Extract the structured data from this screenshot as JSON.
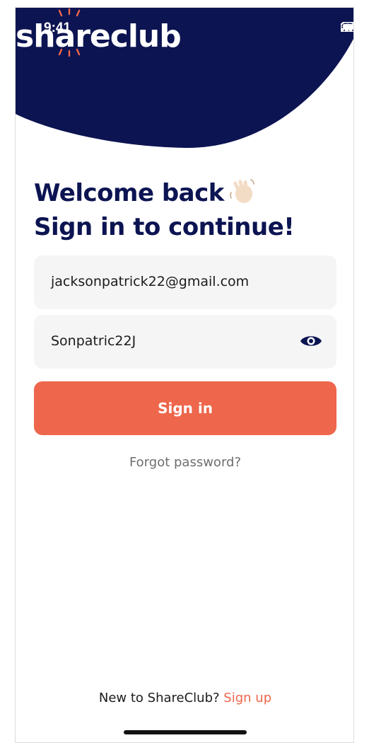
{
  "status_bar": {
    "time": "9:41",
    "signal_icon": "signal-icon",
    "wifi_icon": "wifi-icon",
    "battery_icon": "battery-icon"
  },
  "brand": {
    "logo_text": "shareclub",
    "primary_color": "#0c1452",
    "accent_color": "#ee664b"
  },
  "heading": {
    "line1": "Welcome back",
    "line2": "Sign in to continue!",
    "emoji": "waving-hand-icon"
  },
  "form": {
    "email_value": "jacksonpatrick22@gmail.com",
    "password_value": "Sonpatric22J",
    "password_toggle_icon": "eye-icon",
    "submit_label": "Sign in",
    "forgot_label": "Forgot password?"
  },
  "footer": {
    "prompt": "New to ShareClub?",
    "link_label": "Sign up"
  }
}
